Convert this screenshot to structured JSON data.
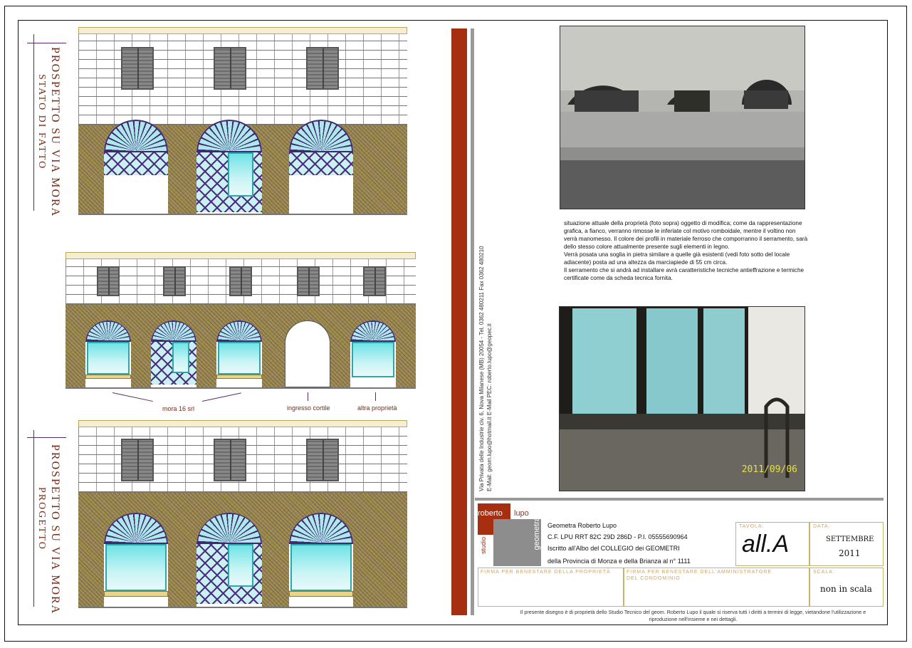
{
  "elevation_top": {
    "title_line1": "PROSPETTO SU VIA MORA",
    "title_line2": "STATO DI FATTO"
  },
  "elevation_middle": {
    "labels": {
      "mora": "mora 16 srl",
      "ingresso": "ingresso cortile",
      "altra": "altra proprietà"
    }
  },
  "elevation_bottom": {
    "title_line1": "PROSPETTO SU VIA MORA",
    "title_line2": "PROGETTO"
  },
  "address_block": {
    "line1": "Via Privata delle Industrie civ. 6, Nova Milanese (MB) 20054 -  Tel. 0362 480211   Fax 0362 480210",
    "line2": "E-Mail: geom.lupo@hotmail.it     E-Mail PEC: roberto.lupo@geopec.it"
  },
  "photos": {
    "top_alt": "facciata stato attuale",
    "bottom_alt": "serramento locale adiacente",
    "date_stamp": "2011/09/06"
  },
  "description": {
    "p1": "situazione attuale della proprietà (foto sopra) oggetto di modifica; come da rappresentazione grafica, a fianco, verranno rimosse le inferiate col motivo romboidale, mentre il voltino non verrà manomesso. Il colore dei profili in materiale ferroso che comporranno il serramento, sarà dello stesso colore attualmente presente sugli elementi in legno.",
    "p2": "Verrà posata una soglia in pietra similare a quelle già esistenti (vedi foto sotto del locale adiacente) posta ad una altezza da marciapiede di 55 cm circa.",
    "p3": "Il serramento che si andrà ad installare avrà caratteristiche tecniche antieffrazione e termiche certificate come da scheda tecnica fornita."
  },
  "title_block": {
    "logo_name_1": "roberto",
    "logo_name_2": "lupo",
    "logo_studio": "studio",
    "logo_profession": "geometra",
    "owner_line1": "Geometra Roberto Lupo",
    "owner_line2": "C.F. LPU RRT 82C 29D 286D - P.I. 05555690964",
    "owner_line3": "Iscritto all'Albo del COLLEGIO dei GEOMETRI",
    "owner_line4": "della Provincia di Monza e della Brianza al n° 1111",
    "tavola_caption": "TAVOLA:",
    "tavola_value": "all.A",
    "data_caption": "DATA:",
    "data_value_1": "SETTEMBRE",
    "data_value_2": "2011",
    "firma_prop": "FIRMA PER BENESTARE DELLA PROPRIETÀ",
    "firma_amm_1": "FIRMA PER BENESTARE DELL'AMMINISTRATORE",
    "firma_amm_2": "DEL CONDOMINIO",
    "scala_caption": "SCALA:",
    "scala_value": "non in scala",
    "footer_1": "Il presente disegno è di proprietà dello Studio Tecnico del geom. Roberto Lupo il quale si riserva tutti i diritti a termini di legge, vietandone l'utilizzazione e",
    "footer_2": "riproduzione nell'insieme e nei dettagli."
  },
  "colors": {
    "accent_red": "#a52f10",
    "accent_grey": "#9a9a9a",
    "stone": "#9a8a48",
    "glass": "#6fe3e6",
    "iron": "#4a2f80"
  }
}
